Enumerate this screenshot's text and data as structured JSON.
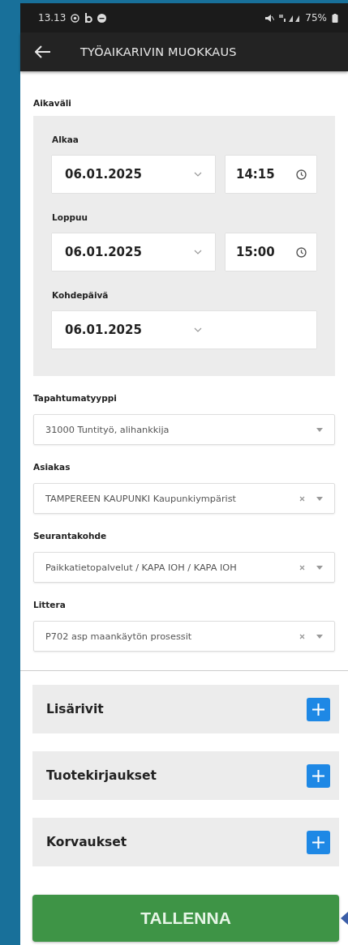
{
  "status_bar": {
    "time": "13.13",
    "battery": "75%"
  },
  "app_bar": {
    "title": "TYÖAIKARIVIN MUOKKAUS"
  },
  "time_range": {
    "label": "Aikaväli",
    "rows": [
      {
        "label": "Alkaa",
        "date": "06.01.2025",
        "time": "14:15"
      },
      {
        "label": "Loppuu",
        "date": "06.01.2025",
        "time": "15:00"
      },
      {
        "label": "Kohdepäivä",
        "date": "06.01.2025"
      }
    ]
  },
  "fields": [
    {
      "label": "Tapahtumatyyppi",
      "value": "31000 Tuntityö, alihankkija",
      "clearable": false
    },
    {
      "label": "Asiakas",
      "value": "TAMPEREEN KAUPUNKI Kaupunkiympärist",
      "clearable": true
    },
    {
      "label": "Seurantakohde",
      "value": "Paikkatietopalvelut / KAPA IOH / KAPA IOH",
      "clearable": true
    },
    {
      "label": "Littera",
      "value": "P702 asp maankäytön prosessit",
      "clearable": true
    }
  ],
  "sections": [
    {
      "label": "Lisärivit"
    },
    {
      "label": "Tuotekirjaukset"
    },
    {
      "label": "Korvaukset"
    }
  ],
  "save_button": "TALLENNA"
}
